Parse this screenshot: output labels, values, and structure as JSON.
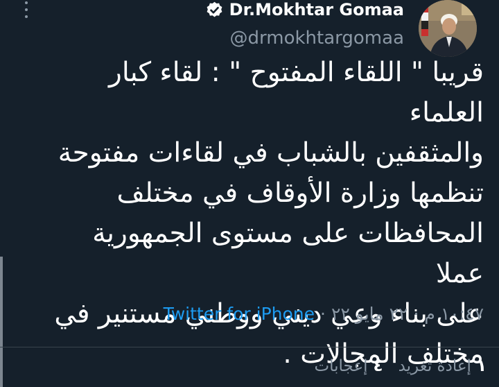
{
  "author": {
    "display_name": "Dr.Mokhtar Gomaa",
    "handle": "@drmokhtargomaa",
    "verified": true
  },
  "tweet": {
    "text": "قريبا \" اللقاء المفتوح \" : لقاء كبار العلماء\nوالمثقفين بالشباب في لقاءات مفتوحة\nتنظمها وزارة الأوقاف في مختلف\nالمحافظات على مستوى الجمهورية عملا\nعلى بناء وعي ديني ووطني مستنير في\nمختلف المجالات ."
  },
  "meta": {
    "time": "١٠:٤٧ م",
    "date": "٢٢ مايو ٢٢",
    "source": "Twitter for iPhone",
    "separator": "·"
  },
  "stats": {
    "retweets_count": "١",
    "retweets_label": "إعادة تغريد",
    "likes_count": "٤",
    "likes_label": "إعجابات"
  },
  "icons": {
    "more": "more-vertical-icon",
    "verified": "verified-badge-icon"
  },
  "colors": {
    "background": "#15202b",
    "secondary_text": "#8b98a5",
    "link": "#1d9bf0",
    "divider": "#38444d"
  }
}
